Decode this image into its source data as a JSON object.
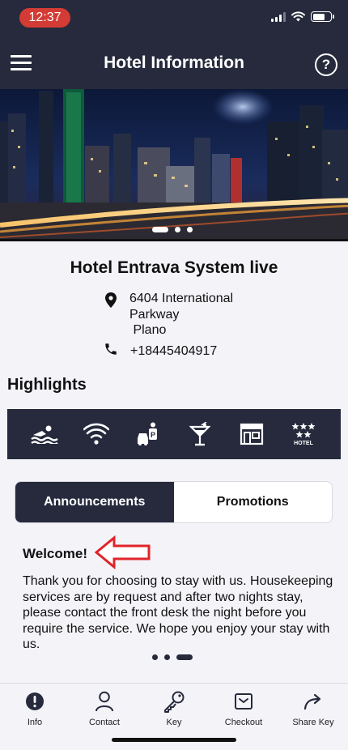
{
  "status": {
    "time": "12:37"
  },
  "header": {
    "title": "Hotel Information",
    "help_label": "?"
  },
  "hotel": {
    "name": "Hotel Entrava System live",
    "address_lines": [
      "6404 International",
      "Parkway",
      " Plano"
    ],
    "phone": "+18445404917"
  },
  "highlights": {
    "title": "Highlights",
    "amenities": [
      "pool-icon",
      "wifi-icon",
      "valet-parking-icon",
      "bar-cocktail-icon",
      "restaurant-storefront-icon",
      "hotel-stars-icon"
    ],
    "hotel_icon_label": "HOTEL"
  },
  "tabs": {
    "announcements": "Announcements",
    "promotions": "Promotions",
    "active": "announcements"
  },
  "announcement": {
    "title": "Welcome!",
    "body": "Thank you for choosing to stay with us. Housekeeping services are by request and after two nights stay, please contact the front desk the night before you require the service. We hope you enjoy your stay with us."
  },
  "carousel": {
    "slides": 3,
    "active": 1
  },
  "announcement_pager": {
    "slides": 3,
    "active": 3
  },
  "bottom_nav": {
    "items": [
      {
        "label": "Info",
        "icon": "info-icon"
      },
      {
        "label": "Contact",
        "icon": "user-icon"
      },
      {
        "label": "Key",
        "icon": "key-icon"
      },
      {
        "label": "Checkout",
        "icon": "checkout-icon"
      },
      {
        "label": "Share Key",
        "icon": "share-icon"
      }
    ]
  },
  "colors": {
    "navy": "#262a3c",
    "time_pill": "#d33b35",
    "arrow": "#e0242a",
    "background": "#f4f3f8"
  }
}
